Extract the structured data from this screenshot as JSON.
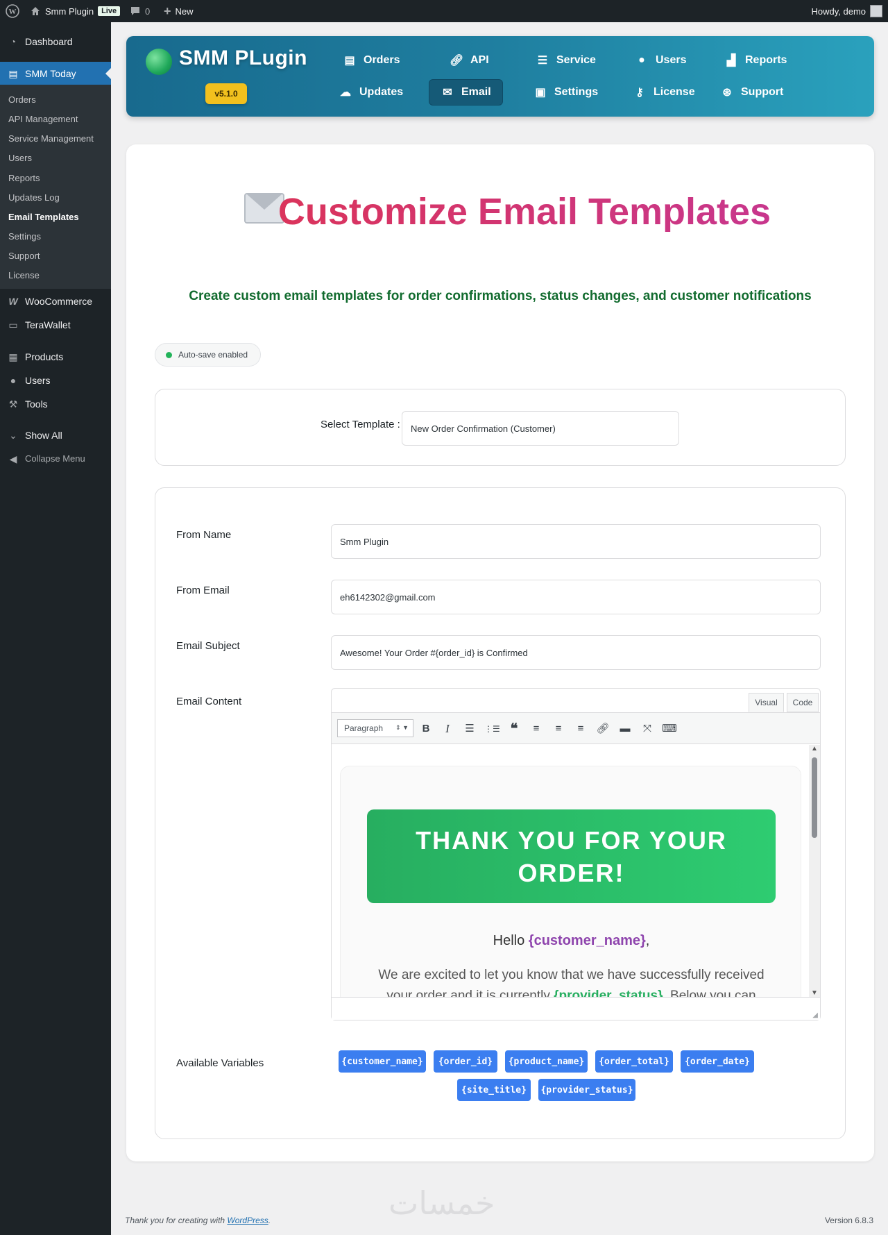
{
  "adminbar": {
    "site": "Smm Plugin",
    "live": "Live",
    "comments": "0",
    "new": "New",
    "howdy": "Howdy, demo"
  },
  "sidebar": {
    "dashboard": "Dashboard",
    "smm_today": "SMM Today",
    "sub": [
      "Orders",
      "API Management",
      "Service Management",
      "Users",
      "Reports",
      "Updates Log",
      "Email Templates",
      "Settings",
      "Support",
      "License"
    ],
    "woocommerce": "WooCommerce",
    "terawallet": "TeraWallet",
    "products": "Products",
    "users": "Users",
    "tools": "Tools",
    "show_all": "Show All",
    "collapse": "Collapse Menu"
  },
  "header": {
    "brand": "SMM PLugin",
    "version": "v5.1.0",
    "nav": [
      "Orders",
      "API",
      "Service",
      "Users",
      "Reports",
      "Updates",
      "Email",
      "Settings",
      "License",
      "Support"
    ]
  },
  "page": {
    "title": "Customize Email Templates",
    "subtitle": "Create custom email templates for order confirmations, status changes, and customer notifications",
    "autosave": "Auto-save enabled",
    "select_label": "Select Template :",
    "select_value": "New Order Confirmation (Customer)"
  },
  "form": {
    "from_name_label": "From Name",
    "from_name": "Smm Plugin",
    "from_email_label": "From Email",
    "from_email": "eh6142302@gmail.com",
    "subject_label": "Email Subject",
    "subject": "Awesome! Your Order #{order_id} is Confirmed",
    "content_label": "Email Content"
  },
  "editor": {
    "tab_visual": "Visual",
    "tab_code": "Code",
    "format": "Paragraph",
    "banner": "THANK YOU FOR YOUR ORDER!",
    "hello_prefix": "Hello ",
    "hello_var": "{customer_name}",
    "hello_suffix": ",",
    "body_1": "We are excited to let you know that we have successfully received your order and it is currently ",
    "body_var": "{provider_status}",
    "body_2": ". Below you can"
  },
  "variables": {
    "label": "Available Variables",
    "items": [
      "{customer_name}",
      "{order_id}",
      "{product_name}",
      "{order_total}",
      "{order_date}",
      "{site_title}",
      "{provider_status}"
    ]
  },
  "footer": {
    "thanks": "Thank you for creating with ",
    "wp": "WordPress",
    "period": ".",
    "version": "Version 6.8.3",
    "watermark": "خمسات"
  }
}
